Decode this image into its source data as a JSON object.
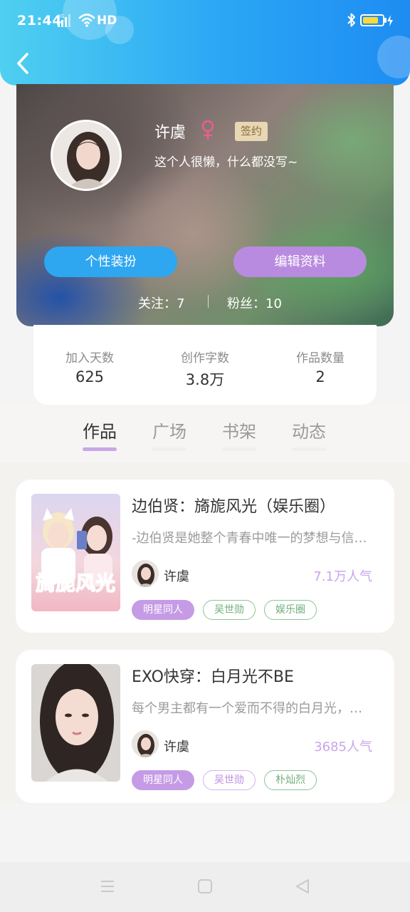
{
  "status_bar": {
    "time": "21:44",
    "network": "HD",
    "battery_level": 0.8,
    "icons": [
      "signal-icon",
      "wifi-icon",
      "bluetooth-icon",
      "battery-icon",
      "charging-icon"
    ]
  },
  "header": {
    "back_icon": "chevron-left-icon"
  },
  "profile": {
    "name": "许虞",
    "gender_symbol": "♀",
    "badge": "签约",
    "bio": "这个人很懒，什么都没写~",
    "dress_button": "个性装扮",
    "edit_button": "编辑资料",
    "following": "关注：7",
    "fans": "粉丝：10"
  },
  "stats": [
    {
      "label": "加入天数",
      "value": "625"
    },
    {
      "label": "创作字数",
      "value": "3.8万"
    },
    {
      "label": "作品数量",
      "value": "2"
    }
  ],
  "tabs": [
    {
      "label": "作品",
      "active": true
    },
    {
      "label": "广场",
      "active": false
    },
    {
      "label": "书架",
      "active": false
    },
    {
      "label": "动态",
      "active": false
    }
  ],
  "books": [
    {
      "title": "边伯贤：旖旎风光（娱乐圈）",
      "description": "-边伯贤是她整个青春中唯一的梦想与信…",
      "author": "许虞",
      "popularity": "7.1万人气",
      "cover_text": "旖旎风光",
      "tags": [
        {
          "label": "明星同人",
          "style": "fill-purple"
        },
        {
          "label": "吴世勋",
          "style": "green"
        },
        {
          "label": "娱乐圈",
          "style": "green"
        }
      ]
    },
    {
      "title": "EXO快穿：白月光不BE",
      "description": "每个男主都有一个爱而不得的白月光，…",
      "author": "许虞",
      "popularity": "3685人气",
      "tags": [
        {
          "label": "明星同人",
          "style": "fill-purple"
        },
        {
          "label": "吴世勋",
          "style": "purple"
        },
        {
          "label": "朴灿烈",
          "style": "green"
        }
      ]
    }
  ],
  "colors": {
    "header_start": "#4fd0f0",
    "header_end": "#1e8cf2",
    "accent_blue": "#2fa6f0",
    "accent_purple": "#b98be0",
    "popularity": "#c9a5ec",
    "tag_green": "#6fb07a"
  },
  "nav_bar": {
    "icons": [
      "menu-icon",
      "home-square-icon",
      "back-triangle-icon"
    ]
  }
}
